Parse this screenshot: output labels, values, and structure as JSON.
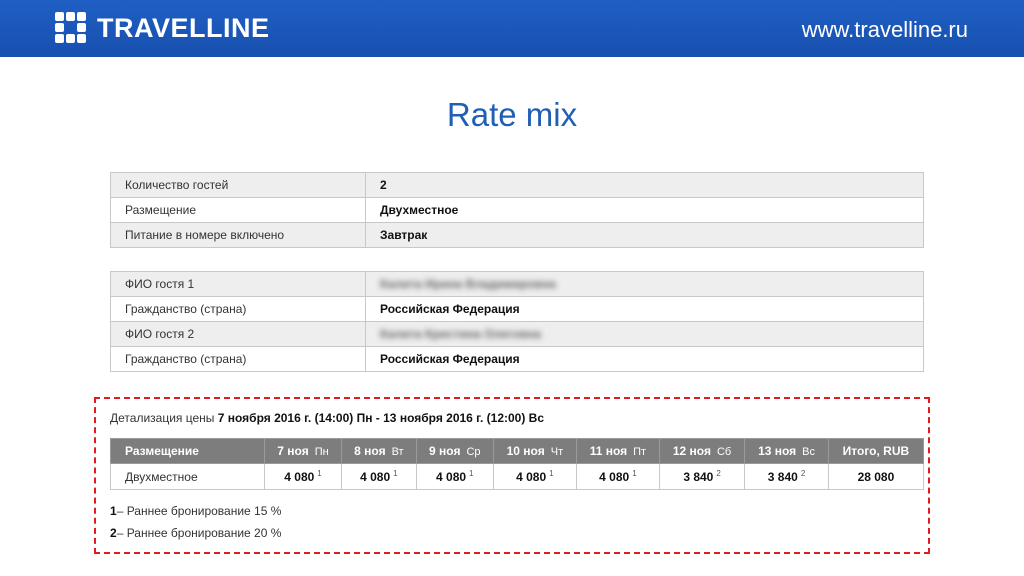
{
  "header": {
    "logo_text": "TRAVELLINE",
    "site_url": "www.travelline.ru",
    "colors": {
      "bar": "#1a56b8",
      "title": "#1f5fb5",
      "highlight_border": "#e01b22"
    }
  },
  "slide": {
    "title": "Rate mix"
  },
  "booking": [
    {
      "label": "Количество гостей",
      "value": "2"
    },
    {
      "label": "Размещение",
      "value": "Двухместное"
    },
    {
      "label": "Питание в номере включено",
      "value": "Завтрак"
    }
  ],
  "guests": [
    {
      "label": "ФИО гостя 1",
      "value": "Калита Ирина Владимировна"
    },
    {
      "label": "Гражданство (страна)",
      "value": "Российская Федерация"
    },
    {
      "label": "ФИО гостя 2",
      "value": "Калита Кристина Олеговна"
    },
    {
      "label": "Гражданство (страна)",
      "value": "Российская Федерация"
    }
  ],
  "detail": {
    "prefix": "Детализация цены",
    "period": "7 ноября 2016 г. (14:00) Пн - 13 ноября 2016 г. (12:00) Вс",
    "columns": [
      {
        "label": "Размещение",
        "dow": ""
      },
      {
        "label": "7 ноя",
        "dow": "Пн"
      },
      {
        "label": "8 ноя",
        "dow": "Вт"
      },
      {
        "label": "9 ноя",
        "dow": "Ср"
      },
      {
        "label": "10 ноя",
        "dow": "Чт"
      },
      {
        "label": "11 ноя",
        "dow": "Пт"
      },
      {
        "label": "12 ноя",
        "dow": "Сб"
      },
      {
        "label": "13 ноя",
        "dow": "Вс"
      },
      {
        "label": "Итого, RUB",
        "dow": ""
      }
    ],
    "row": {
      "room": "Двухместное",
      "prices": [
        {
          "value": "4 080",
          "mark": "1"
        },
        {
          "value": "4 080",
          "mark": "1"
        },
        {
          "value": "4 080",
          "mark": "1"
        },
        {
          "value": "4 080",
          "mark": "1"
        },
        {
          "value": "4 080",
          "mark": "1"
        },
        {
          "value": "3 840",
          "mark": "2"
        },
        {
          "value": "3 840",
          "mark": "2"
        }
      ],
      "total": "28 080"
    },
    "notes": [
      {
        "num": "1",
        "text": "– Раннее бронирование 15 %"
      },
      {
        "num": "2",
        "text": "– Раннее бронирование 20 %"
      }
    ]
  }
}
